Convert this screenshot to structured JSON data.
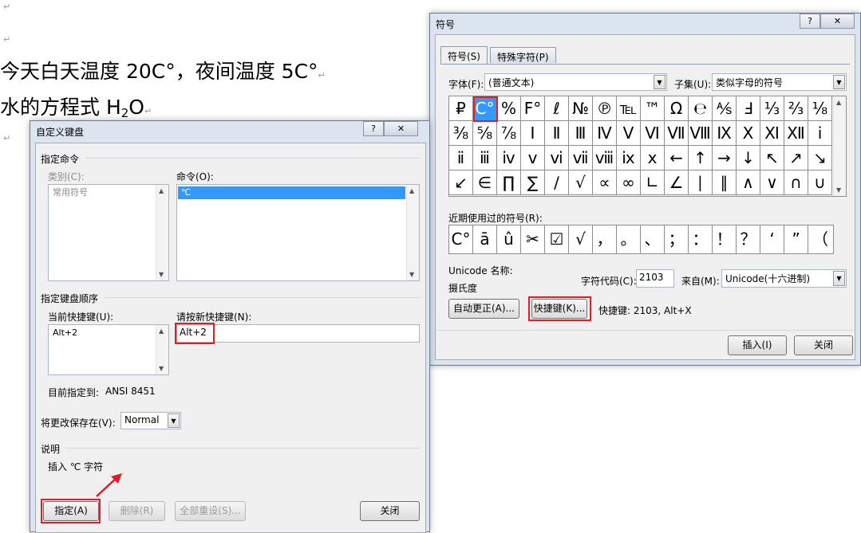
{
  "document": {
    "line1": "今天白天温度 20C°，夜间温度 5C°",
    "line2_prefix": "水的方程式 H",
    "line2_sub": "2",
    "line2_suffix": "O",
    "para_mark": "↵"
  },
  "customize_dialog": {
    "title": "自定义键盘",
    "help": "?",
    "close": "✕",
    "section_command": "指定命令",
    "category_label": "类别(C):",
    "category_items": [
      "常用符号"
    ],
    "command_label": "命令(O):",
    "command_items": [
      "℃"
    ],
    "section_keys": "指定键盘顺序",
    "current_keys_label": "当前快捷键(U):",
    "current_keys_items": [
      "Alt+2"
    ],
    "new_key_label": "请按新快捷键(N):",
    "new_key_value": "Alt+2",
    "assigned_to_label": "目前指定到:",
    "assigned_to_value": "ANSI 8451",
    "save_in_label": "将更改保存在(V):",
    "save_in_value": "Normal",
    "section_desc": "说明",
    "description": "插入 ℃ 字符",
    "assign_button": "指定(A)",
    "remove_button": "删除(R)",
    "reset_all_button": "全部重设(S)...",
    "close_button": "关闭"
  },
  "symbol_dialog": {
    "title": "符号",
    "help": "?",
    "close": "✕",
    "tabs": [
      "符号(S)",
      "特殊字符(P)"
    ],
    "font_label": "字体(F):",
    "font_value": "(普通文本)",
    "subset_label": "子集(U):",
    "subset_value": "类似字母的符号",
    "symbols": [
      [
        "₽",
        "C°",
        "%",
        "F°",
        "ℓ",
        "№",
        "℗",
        "℡",
        "™",
        "Ω",
        "℮",
        "⅍",
        "Ⅎ",
        "⅓",
        "⅔",
        "⅛"
      ],
      [
        "⅜",
        "⅝",
        "⅞",
        "Ⅰ",
        "Ⅱ",
        "Ⅲ",
        "Ⅳ",
        "Ⅴ",
        "Ⅵ",
        "Ⅶ",
        "Ⅷ",
        "Ⅸ",
        "Ⅹ",
        "Ⅺ",
        "Ⅻ",
        "ⅰ"
      ],
      [
        "ⅱ",
        "ⅲ",
        "ⅳ",
        "ⅴ",
        "ⅵ",
        "ⅶ",
        "ⅷ",
        "ⅸ",
        "ⅹ",
        "←",
        "↑",
        "→",
        "↓",
        "↖",
        "↗",
        "↘"
      ],
      [
        "↙",
        "∈",
        "∏",
        "∑",
        "∕",
        "√",
        "∝",
        "∞",
        "∟",
        "∠",
        "∣",
        "∥",
        "∧",
        "∨",
        "∩",
        "∪"
      ]
    ],
    "recent_label": "近期使用过的符号(R):",
    "recent_symbols": [
      "C°",
      "ā",
      "û",
      "✂",
      "☑",
      "√",
      "，",
      "。",
      "、",
      "；",
      "：",
      "！",
      "？",
      "‘",
      "”",
      "（"
    ],
    "unicode_name_label": "Unicode 名称:",
    "unicode_name_value": "摄氏度",
    "char_code_label": "字符代码(C):",
    "char_code_value": "2103",
    "from_label": "来自(M):",
    "from_value": "Unicode(十六进制)",
    "autocorrect_button": "自动更正(A)...",
    "shortcut_button": "快捷键(K)...",
    "shortcut_text": "快捷键: 2103, Alt+X",
    "insert_button": "插入(I)",
    "close_button": "关闭"
  }
}
